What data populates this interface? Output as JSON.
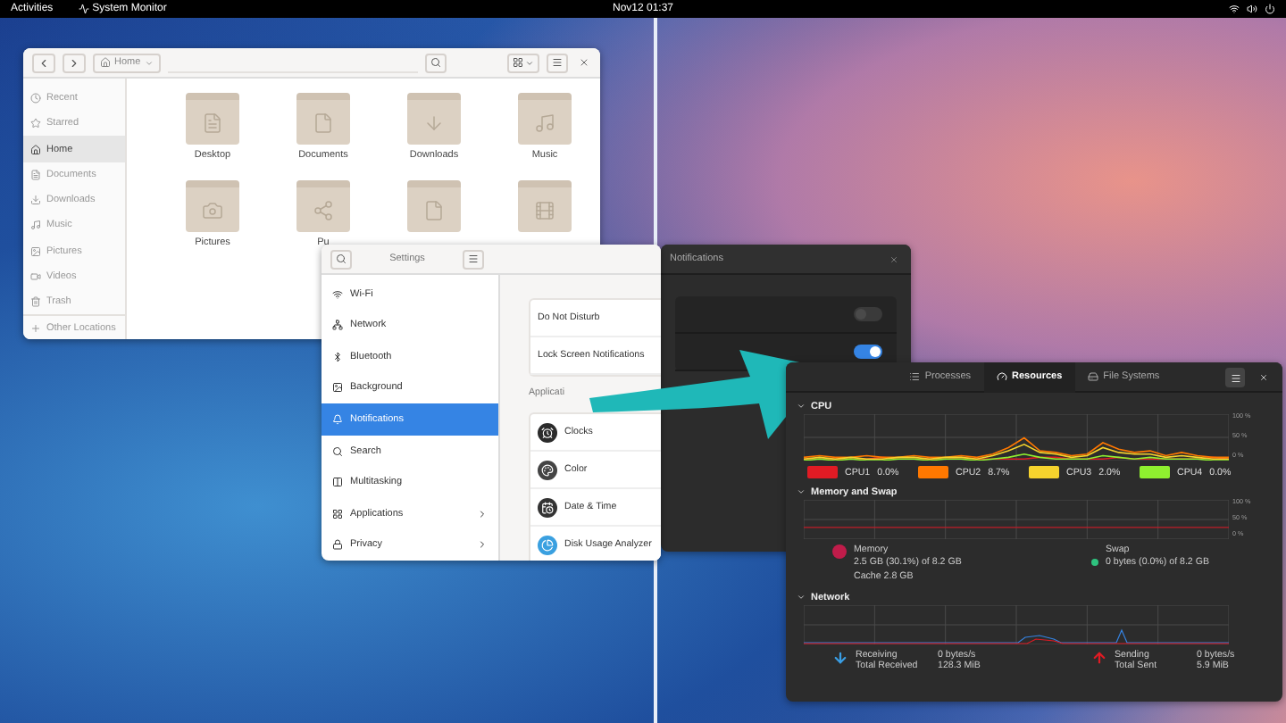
{
  "top_bar": {
    "activities": "Activities",
    "app_menu": "System Monitor",
    "clock": "Nov12 01:37"
  },
  "files_window": {
    "path": "Home",
    "sidebar": [
      {
        "label": "Recent",
        "kind": "recent",
        "selected": false
      },
      {
        "label": "Starred",
        "kind": "starred",
        "selected": false
      },
      {
        "label": "Home",
        "kind": "home",
        "selected": true
      },
      {
        "label": "Documents",
        "kind": "documents",
        "selected": false
      },
      {
        "label": "Downloads",
        "kind": "downloads",
        "selected": false
      },
      {
        "label": "Music",
        "kind": "music",
        "selected": false
      },
      {
        "label": "Pictures",
        "kind": "pictures",
        "selected": false
      },
      {
        "label": "Videos",
        "kind": "videos",
        "selected": false
      },
      {
        "label": "Trash",
        "kind": "trash",
        "selected": false
      }
    ],
    "other_locations": "Other Locations",
    "folders": [
      {
        "label": "Desktop",
        "kind": "desktop"
      },
      {
        "label": "Documents",
        "kind": "documents"
      },
      {
        "label": "Downloads",
        "kind": "downloads"
      },
      {
        "label": "Music",
        "kind": "music"
      },
      {
        "label": "Pictures",
        "kind": "pictures"
      },
      {
        "label": "Pu",
        "kind": "public"
      },
      {
        "kind": "templates"
      },
      {
        "kind": "videos"
      }
    ]
  },
  "settings_window": {
    "title": "Settings",
    "sidebar": [
      {
        "label": "Wi-Fi",
        "kind": "wifi",
        "selected": false,
        "submenu": false
      },
      {
        "label": "Network",
        "kind": "network",
        "selected": false,
        "submenu": false
      },
      {
        "label": "Bluetooth",
        "kind": "bluetooth",
        "selected": false,
        "submenu": false
      },
      {
        "label": "Background",
        "kind": "background",
        "selected": false,
        "submenu": false
      },
      {
        "label": "Notifications",
        "kind": "notifications",
        "selected": true,
        "submenu": false
      },
      {
        "label": "Search",
        "kind": "search",
        "selected": false,
        "submenu": false
      },
      {
        "label": "Multitasking",
        "kind": "multitasking",
        "selected": false,
        "submenu": false
      },
      {
        "label": "Applications",
        "kind": "applications",
        "selected": false,
        "submenu": true
      },
      {
        "label": "Privacy",
        "kind": "privacy",
        "selected": false,
        "submenu": true
      }
    ],
    "rows": [
      "Do Not Disturb",
      "Lock Screen Notifications"
    ],
    "section": "Applicati",
    "apps": [
      {
        "label": "Clocks",
        "kind": "clocks"
      },
      {
        "label": "Color",
        "kind": "color"
      },
      {
        "label": "Date & Time",
        "kind": "datetime"
      },
      {
        "label": "Disk Usage Analyzer",
        "kind": "disk"
      }
    ]
  },
  "notifications_window": {
    "title": "Notifications",
    "toggles": [
      {
        "on": false
      },
      {
        "on": true
      }
    ]
  },
  "system_monitor": {
    "tabs": [
      {
        "label": "Processes",
        "kind": "processes",
        "selected": false
      },
      {
        "label": "Resources",
        "kind": "resources",
        "selected": true
      },
      {
        "label": "File Systems",
        "kind": "filesystems",
        "selected": false
      }
    ],
    "cpu": {
      "title": "CPU",
      "axis_labels": [
        "100 %",
        "50 %",
        "0 %"
      ],
      "legend": [
        {
          "name": "CPU1",
          "reading": "0.0%",
          "color": "#e01b24"
        },
        {
          "name": "CPU2",
          "reading": "8.7%",
          "color": "#ff7800"
        },
        {
          "name": "CPU3",
          "reading": "2.0%",
          "color": "#f6d32d"
        },
        {
          "name": "CPU4",
          "reading": "0.0%",
          "color": "#8ff02f"
        }
      ]
    },
    "memory": {
      "title": "Memory and Swap",
      "axis_labels": [
        "100 %",
        "50 %",
        "0 %"
      ],
      "memory_label": "Memory",
      "memory_value": "2.5 GB (30.1%) of 8.2 GB",
      "cache": "Cache 2.8 GB",
      "swap_label": "Swap",
      "swap_value": "0 bytes (0.0%) of 8.2 GB"
    },
    "network": {
      "title": "Network",
      "receiving_label": "Receiving",
      "receiving_value": "0 bytes/s",
      "total_received_label": "Total Received",
      "total_received_value": "128.3 MiB",
      "sending_label": "Sending",
      "sending_value": "0 bytes/s",
      "total_sent_label": "Total Sent",
      "total_sent_value": "5.9 MiB"
    }
  }
}
